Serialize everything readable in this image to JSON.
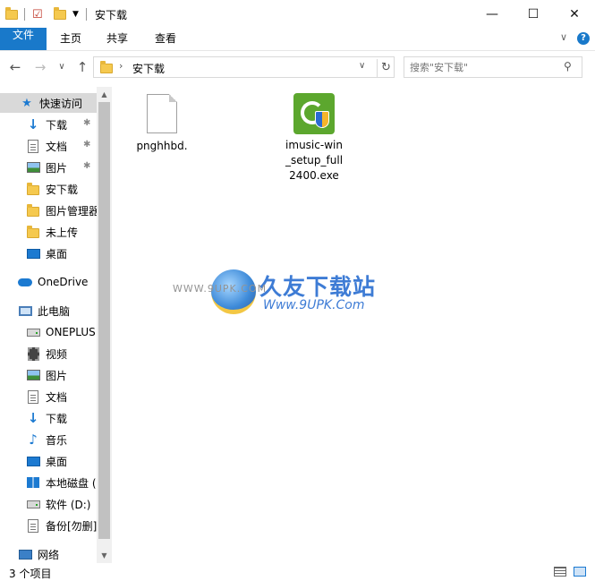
{
  "window": {
    "title": "安下载",
    "minimize": "—",
    "maximize": "☐",
    "close": "✕"
  },
  "ribbon": {
    "tabs": [
      "文件",
      "主页",
      "共享",
      "查看"
    ],
    "expand": "∨",
    "help": "?"
  },
  "address": {
    "back": "←",
    "forward": "→",
    "recent": "∨",
    "up": "↑",
    "crumb": "安下载",
    "dropdown": "∨",
    "refresh": "↻"
  },
  "search": {
    "placeholder": "搜索\"安下载\""
  },
  "nav": {
    "quick_access": "快速访问",
    "quick_items": [
      "下载",
      "文档",
      "图片",
      "安下载",
      "图片管理器",
      "未上传",
      "桌面"
    ],
    "onedrive": "OneDrive",
    "this_pc": "此电脑",
    "pc_items": [
      "ONEPLUS",
      "视频",
      "图片",
      "文档",
      "下载",
      "音乐",
      "桌面",
      "本地磁盘 (C:)",
      "软件 (D:)",
      "备份[勿删]"
    ],
    "network": "网络"
  },
  "files": [
    {
      "name": "pnghhbd.",
      "icon": "document-icon"
    },
    {
      "name": "imusic-win\n_setup_full\n2400.exe",
      "icon": "imusic-app-icon"
    }
  ],
  "watermark": {
    "brand": "久友下载站",
    "url": "Www.9UPK.Com",
    "url_faint": "WWW.9UPK.COM"
  },
  "status": {
    "count": "3 个项目"
  },
  "colors": {
    "accent": "#1979ca",
    "selected_nav": "#d9d9d9"
  }
}
